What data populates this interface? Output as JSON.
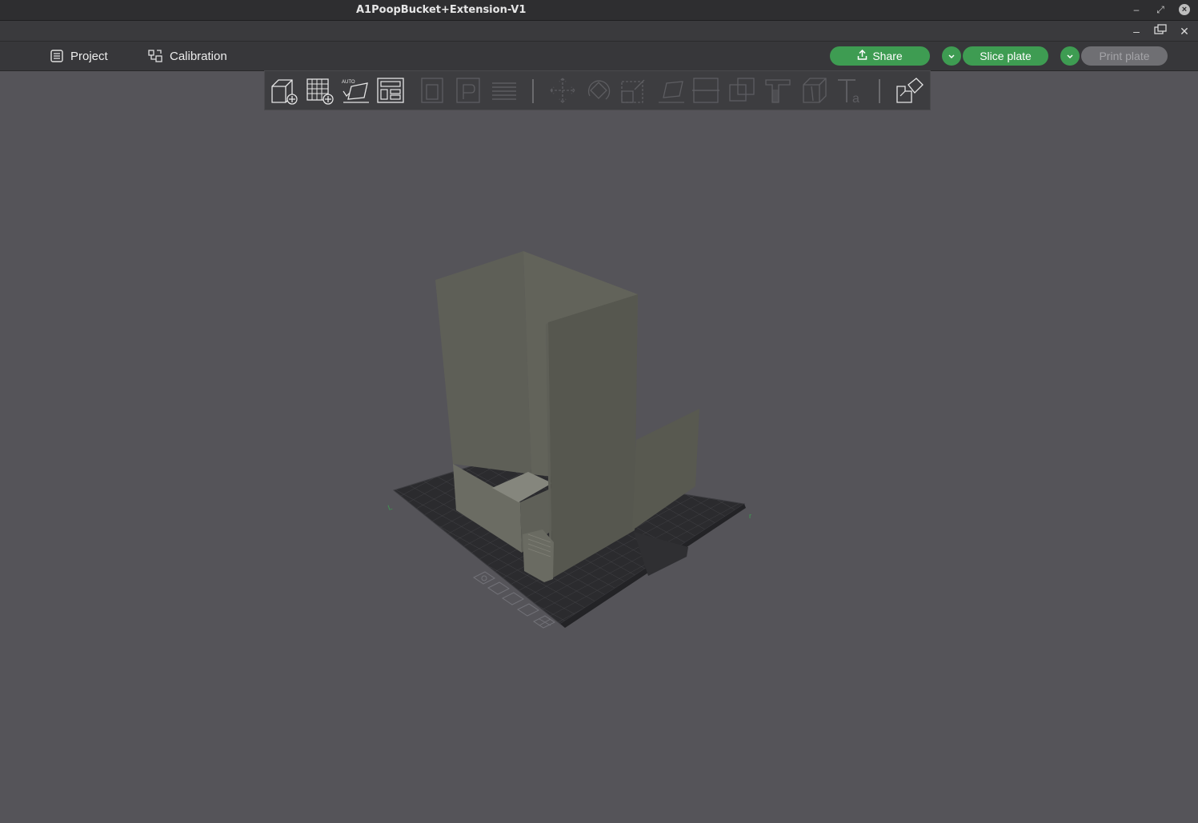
{
  "window": {
    "title": "A1PoopBucket+Extension-V1"
  },
  "tabs": [
    {
      "label": "Project"
    },
    {
      "label": "Calibration"
    }
  ],
  "actions": {
    "share_label": "Share",
    "slice_label": "Slice plate",
    "print_label": "Print plate"
  },
  "colors": {
    "accent_green": "#3e9c52",
    "viewport_bg": "#555459",
    "model_color": "#6a6b60",
    "bed_color": "#2b2b2e"
  },
  "toolbar_icons": [
    "add-object-icon",
    "add-plate-icon",
    "auto-orient-icon",
    "arrange-icon",
    "orient-icon",
    "plate-settings-icon",
    "layers-icon",
    "move-icon",
    "rotate-icon",
    "scale-icon",
    "lay-on-face-icon",
    "cut-icon",
    "boolean-icon",
    "support-paint-icon",
    "seam-paint-icon",
    "text-icon",
    "assembly-icon"
  ]
}
